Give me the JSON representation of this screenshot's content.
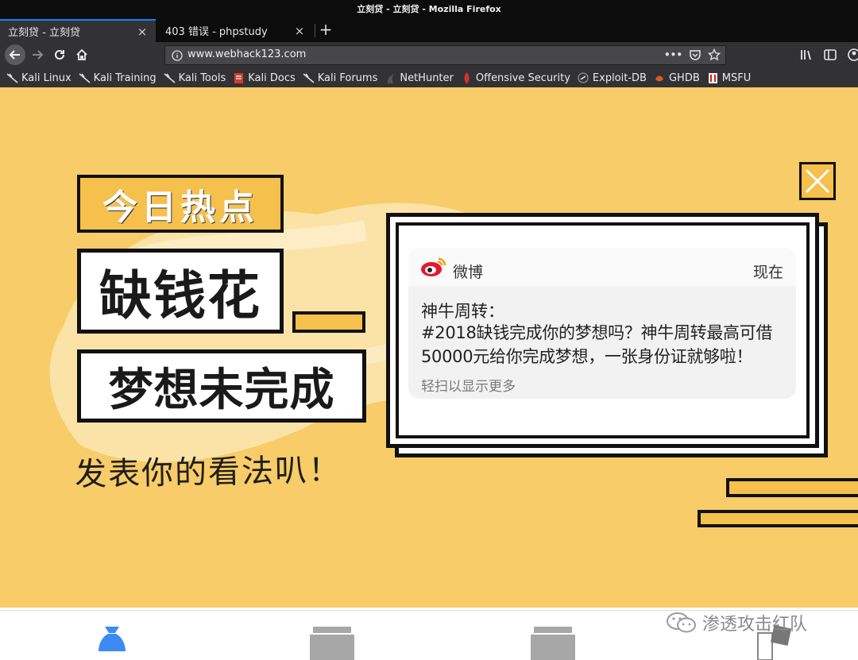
{
  "window": {
    "title": "立刻贷 - 立刻贷 - Mozilla Firefox"
  },
  "tabs": [
    {
      "label": "立刻贷 - 立刻贷",
      "close": "×"
    },
    {
      "label": "403 错误 - phpstudy",
      "close": "×"
    }
  ],
  "new_tab": "+",
  "address_bar": {
    "url": "www.webhack123.com",
    "page_actions": "•••"
  },
  "bookmarks": [
    {
      "label": "Kali Linux",
      "icon": "kali-dragon-icon"
    },
    {
      "label": "Kali Training",
      "icon": "kali-dragon-icon"
    },
    {
      "label": "Kali Tools",
      "icon": "kali-dragon-icon"
    },
    {
      "label": "Kali Docs",
      "icon": "red-docs-icon"
    },
    {
      "label": "Kali Forums",
      "icon": "kali-dragon-icon"
    },
    {
      "label": "NetHunter",
      "icon": "nethunter-icon"
    },
    {
      "label": "Offensive Security",
      "icon": "offsec-icon"
    },
    {
      "label": "Exploit-DB",
      "icon": "exploitdb-icon"
    },
    {
      "label": "GHDB",
      "icon": "ghdb-icon"
    },
    {
      "label": "MSFU",
      "icon": "msfu-icon"
    }
  ],
  "banner": {
    "hot_topic": "今日热点",
    "line1": "缺钱花",
    "line2": "梦想未完成",
    "comment_prompt": "发表你的看法叭！"
  },
  "notification": {
    "app": "微博",
    "time": "现在",
    "title": "神牛周转：",
    "body": "#2018缺钱完成你的梦想吗？神牛周转最高可借50000元给你完成梦想，一张身份证就够啦！",
    "hint": "轻扫以显示更多"
  },
  "watermark": {
    "text": "渗透攻击红队"
  },
  "colors": {
    "banner_bg": "#f8cc68",
    "accent_yellow": "#f5c04c",
    "tab_accent": "#0a84ff",
    "nav_active": "#3d8af7"
  }
}
